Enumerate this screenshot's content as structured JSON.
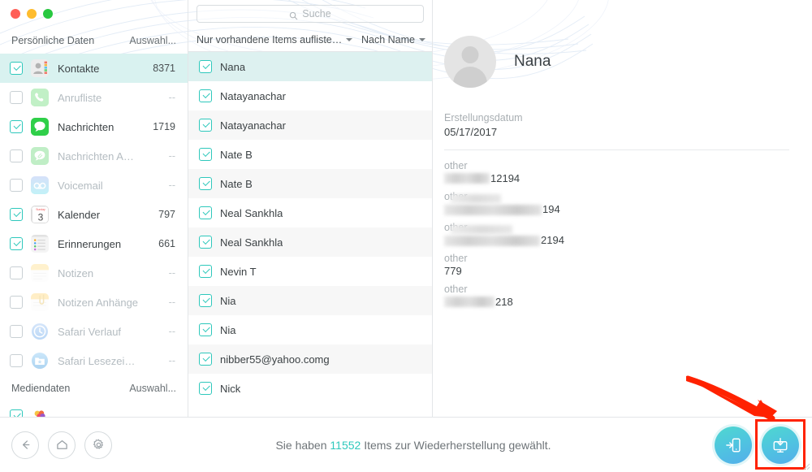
{
  "window": {
    "traffic_lights": [
      "close",
      "minimize",
      "zoom"
    ]
  },
  "sidebar": {
    "sections": [
      {
        "title": "Persönliche Daten",
        "right_label": "Auswahl...",
        "items": [
          {
            "label": "Kontakte",
            "count": "8371",
            "checked": true,
            "selected": true,
            "enabled": true,
            "icon": "contacts-icon"
          },
          {
            "label": "Anrufliste",
            "count": "--",
            "checked": false,
            "selected": false,
            "enabled": false,
            "icon": "phone-icon"
          },
          {
            "label": "Nachrichten",
            "count": "1719",
            "checked": true,
            "selected": false,
            "enabled": true,
            "icon": "messages-icon"
          },
          {
            "label": "Nachrichten A…",
            "count": "--",
            "checked": false,
            "selected": false,
            "enabled": false,
            "icon": "message-attachments-icon"
          },
          {
            "label": "Voicemail",
            "count": "--",
            "checked": false,
            "selected": false,
            "enabled": false,
            "icon": "voicemail-icon"
          },
          {
            "label": "Kalender",
            "count": "797",
            "checked": true,
            "selected": false,
            "enabled": true,
            "icon": "calendar-icon"
          },
          {
            "label": "Erinnerungen",
            "count": "661",
            "checked": true,
            "selected": false,
            "enabled": true,
            "icon": "reminders-icon"
          },
          {
            "label": "Notizen",
            "count": "--",
            "checked": false,
            "selected": false,
            "enabled": false,
            "icon": "notes-icon"
          },
          {
            "label": "Notizen Anhänge",
            "count": "--",
            "checked": false,
            "selected": false,
            "enabled": false,
            "icon": "notes-attachments-icon"
          },
          {
            "label": "Safari Verlauf",
            "count": "--",
            "checked": false,
            "selected": false,
            "enabled": false,
            "icon": "safari-history-icon"
          },
          {
            "label": "Safari Lesezei…",
            "count": "--",
            "checked": false,
            "selected": false,
            "enabled": false,
            "icon": "safari-bookmarks-icon"
          }
        ]
      },
      {
        "title": "Mediendaten",
        "right_label": "Auswahl...",
        "items": [
          {
            "label": "",
            "count": "",
            "checked": true,
            "selected": false,
            "enabled": true,
            "icon": "photos-icon"
          }
        ]
      }
    ]
  },
  "list": {
    "search": {
      "placeholder": "Suche",
      "value": "",
      "icon": "search-icon"
    },
    "filter": {
      "label": "Nur vorhandene Items aufliste…",
      "icon": "chevron-down-icon"
    },
    "sort": {
      "label": "Nach Name",
      "icon": "chevron-down-icon"
    },
    "rows": [
      {
        "name": "Nana",
        "checked": true,
        "selected": true
      },
      {
        "name": "Natayanachar",
        "checked": true,
        "selected": false
      },
      {
        "name": "Natayanachar",
        "checked": true,
        "selected": false
      },
      {
        "name": "Nate B",
        "checked": true,
        "selected": false
      },
      {
        "name": "Nate B",
        "checked": true,
        "selected": false
      },
      {
        "name": "Neal Sankhla",
        "checked": true,
        "selected": false
      },
      {
        "name": "Neal Sankhla",
        "checked": true,
        "selected": false
      },
      {
        "name": "Nevin T",
        "checked": true,
        "selected": false
      },
      {
        "name": "Nia",
        "checked": true,
        "selected": false
      },
      {
        "name": "Nia",
        "checked": true,
        "selected": false
      },
      {
        "name": "nibber55@yahoo.comg",
        "checked": true,
        "selected": false
      },
      {
        "name": "Nick",
        "checked": true,
        "selected": false
      }
    ]
  },
  "detail": {
    "name": "Nana",
    "avatar_icon": "person-placeholder-avatar",
    "created_label": "Erstellungsdatum",
    "created_value": "05/17/2017",
    "fields": [
      {
        "label": "other",
        "value": "12194",
        "redacted": true,
        "redact_width": 56
      },
      {
        "label": "other",
        "value": "194",
        "redacted": true,
        "redact_width": 120
      },
      {
        "label": "other",
        "value": "2194",
        "redacted": true,
        "redact_width": 118
      },
      {
        "label": "other",
        "value": "779",
        "redacted": false,
        "redact_width": 0
      },
      {
        "label": "other",
        "value": "218",
        "redacted": true,
        "redact_width": 62
      }
    ]
  },
  "bottom": {
    "nav": [
      {
        "name": "back-button",
        "icon": "arrow-left-icon"
      },
      {
        "name": "home-button",
        "icon": "home-icon"
      },
      {
        "name": "settings-button",
        "icon": "gear-icon"
      }
    ],
    "status_prefix": "Sie haben ",
    "status_count": "11552",
    "status_suffix": " Items zur Wiederherstellung gewählt.",
    "actions": [
      {
        "name": "restore-to-device-button",
        "icon": "phone-import-icon",
        "highlighted": false
      },
      {
        "name": "restore-to-computer-button",
        "icon": "monitor-download-icon",
        "highlighted": true
      }
    ]
  },
  "annotation": {
    "arrow_color": "#ff2200",
    "highlight_color": "#ff2200"
  },
  "colors": {
    "accent_teal": "#2ec8bc",
    "selected_row": "#ddf1f0",
    "alt_row": "#f7f7f7"
  }
}
